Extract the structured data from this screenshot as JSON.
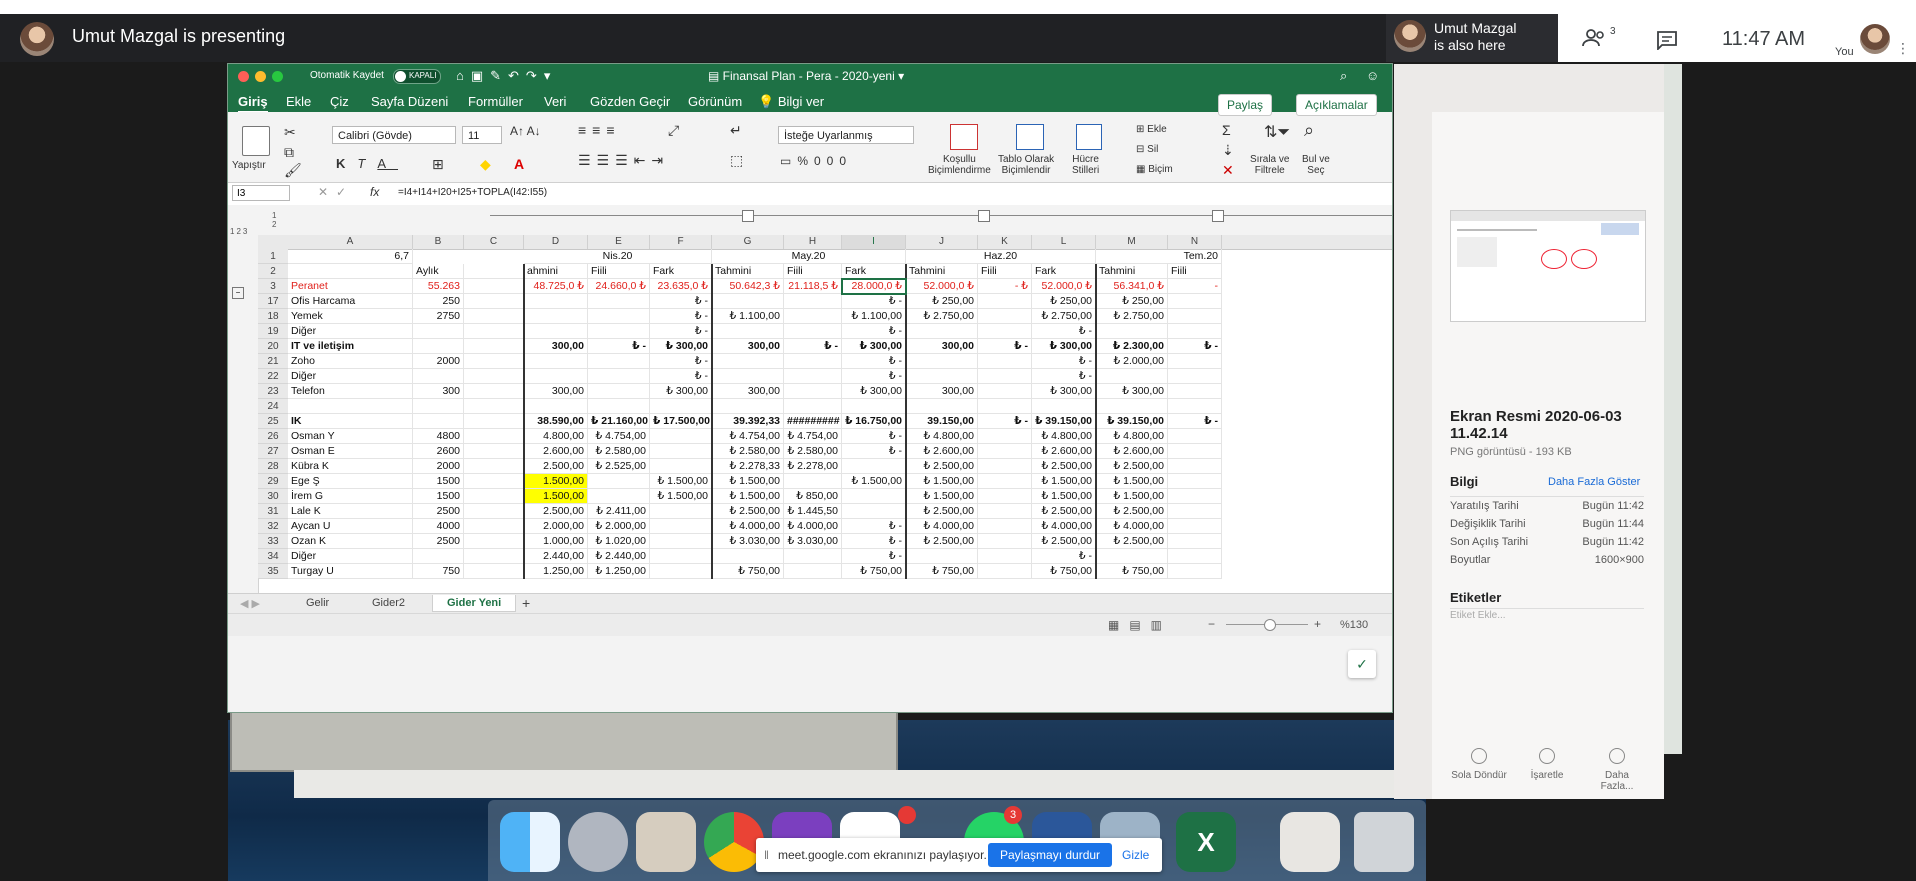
{
  "meet": {
    "presenter_text": "Umut Mazgal is presenting",
    "also_here_name": "Umut Mazgal",
    "also_here_suffix": "is also here",
    "people_count": "3",
    "time": "11:47 AM",
    "you_label": "You"
  },
  "excel": {
    "autosave_label": "Otomatik Kaydet",
    "autosave_state": "KAPALI",
    "doc_title": "Finansal Plan - Pera - 2020-yeni",
    "tabs": [
      "Giriş",
      "Ekle",
      "Çiz",
      "Sayfa Düzeni",
      "Formüller",
      "Veri",
      "Gözden Geçir",
      "Görünüm",
      "Bilgi ver"
    ],
    "share_label": "Paylaş",
    "comments_label": "Açıklamalar",
    "paste_label": "Yapıştır",
    "font_name": "Calibri (Gövde)",
    "font_size": "11",
    "number_format": "İsteğe Uyarlanmış",
    "ribbon_groups": {
      "conditional": "Koşullu\nBiçimlendirme",
      "table": "Tablo Olarak\nBiçimlendir",
      "cell_styles": "Hücre\nStilleri",
      "insert": "Ekle",
      "delete": "Sil",
      "format": "Biçim",
      "sort": "Sırala ve\nFiltrele",
      "find": "Bul ve\nSeç"
    },
    "name_box": "I3",
    "formula": "=I4+I14+I20+I25+TOPLA(I42:I55)",
    "columns": [
      "A",
      "B",
      "C",
      "D",
      "E",
      "F",
      "G",
      "H",
      "I",
      "J",
      "K",
      "L",
      "M",
      "N"
    ],
    "outline_levels": [
      "1",
      "2",
      "3"
    ],
    "row1": {
      "a": "6,7",
      "month_apr": "Nis.20",
      "month_may": "May.20",
      "month_jun": "Haz.20",
      "month_jul": "Tem.20"
    },
    "row2": {
      "b": "Aylık",
      "d": "ahmini",
      "e": "Fiili",
      "f": "Fark",
      "g": "Tahmini",
      "h": "Fiili",
      "i": "Fark",
      "j": "Tahmini",
      "k": "Fiili",
      "l": "Fark",
      "m": "Tahmini",
      "n": "Fiili"
    },
    "rows": [
      {
        "n": "3",
        "a": "Peranet",
        "b": "55.263",
        "d": "48.725,0 ₺",
        "e": "24.660,0 ₺",
        "f": "23.635,0 ₺",
        "g": "50.642,3 ₺",
        "h": "21.118,5 ₺",
        "i": "28.000,0 ₺",
        "j": "52.000,0 ₺",
        "k": "- ₺",
        "l": "52.000,0 ₺",
        "m": "56.341,0 ₺",
        "nn": "-"
      },
      {
        "n": "17",
        "a": "Ofis Harcama",
        "b": "250",
        "d": "",
        "e": "",
        "f": "₺ -",
        "g": "",
        "h": "",
        "i": "₺ -",
        "j": "₺ 250,00",
        "k": "",
        "l": "₺ 250,00",
        "m": "₺ 250,00",
        "nn": ""
      },
      {
        "n": "18",
        "a": "Yemek",
        "b": "2750",
        "d": "",
        "e": "",
        "f": "₺ -",
        "g": "₺ 1.100,00",
        "h": "",
        "i": "₺ 1.100,00",
        "j": "₺ 2.750,00",
        "k": "",
        "l": "₺ 2.750,00",
        "m": "₺ 2.750,00",
        "nn": ""
      },
      {
        "n": "19",
        "a": "Diğer",
        "b": "",
        "d": "",
        "e": "",
        "f": "₺ -",
        "g": "",
        "h": "",
        "i": "₺ -",
        "j": "",
        "k": "",
        "l": "₺ -",
        "m": "",
        "nn": ""
      },
      {
        "n": "20",
        "a": "IT ve iletişim",
        "b": "",
        "d": "300,00",
        "e": "₺ -",
        "f": "₺ 300,00",
        "g": "300,00",
        "h": "₺ -",
        "i": "₺ 300,00",
        "j": "300,00",
        "k": "₺ -",
        "l": "₺ 300,00",
        "m": "₺ 2.300,00",
        "nn": "₺ -",
        "bold": true
      },
      {
        "n": "21",
        "a": "Zoho",
        "b": "2000",
        "d": "",
        "e": "",
        "f": "₺ -",
        "g": "",
        "h": "",
        "i": "₺ -",
        "j": "",
        "k": "",
        "l": "₺ -",
        "m": "₺ 2.000,00",
        "nn": ""
      },
      {
        "n": "22",
        "a": "Diğer",
        "b": "",
        "d": "",
        "e": "",
        "f": "₺ -",
        "g": "",
        "h": "",
        "i": "₺ -",
        "j": "",
        "k": "",
        "l": "₺ -",
        "m": "",
        "nn": ""
      },
      {
        "n": "23",
        "a": "Telefon",
        "b": "300",
        "d": "300,00",
        "e": "",
        "f": "₺ 300,00",
        "g": "300,00",
        "h": "",
        "i": "₺ 300,00",
        "j": "300,00",
        "k": "",
        "l": "₺ 300,00",
        "m": "₺ 300,00",
        "nn": ""
      },
      {
        "n": "24",
        "a": "",
        "b": "",
        "d": "",
        "e": "",
        "f": "",
        "g": "",
        "h": "",
        "i": "",
        "j": "",
        "k": "",
        "l": "",
        "m": "",
        "nn": ""
      },
      {
        "n": "25",
        "a": "IK",
        "b": "",
        "d": "38.590,00",
        "e": "₺ 21.160,00",
        "f": "₺ 17.500,00",
        "g": "39.392,33",
        "h": "#########",
        "i": "₺ 16.750,00",
        "j": "39.150,00",
        "k": "₺ -",
        "l": "₺ 39.150,00",
        "m": "₺ 39.150,00",
        "nn": "₺ -",
        "bold": true
      },
      {
        "n": "26",
        "a": "Osman Y",
        "b": "4800",
        "d": "4.800,00",
        "e": "₺ 4.754,00",
        "f": "",
        "g": "₺ 4.754,00",
        "h": "₺ 4.754,00",
        "i": "₺ -",
        "j": "₺ 4.800,00",
        "k": "",
        "l": "₺ 4.800,00",
        "m": "₺ 4.800,00",
        "nn": ""
      },
      {
        "n": "27",
        "a": "Osman E",
        "b": "2600",
        "d": "2.600,00",
        "e": "₺ 2.580,00",
        "f": "",
        "g": "₺ 2.580,00",
        "h": "₺ 2.580,00",
        "i": "₺ -",
        "j": "₺ 2.600,00",
        "k": "",
        "l": "₺ 2.600,00",
        "m": "₺ 2.600,00",
        "nn": ""
      },
      {
        "n": "28",
        "a": "Kübra K",
        "b": "2000",
        "d": "2.500,00",
        "e": "₺ 2.525,00",
        "f": "",
        "g": "₺ 2.278,33",
        "h": "₺ 2.278,00",
        "i": "",
        "j": "₺ 2.500,00",
        "k": "",
        "l": "₺ 2.500,00",
        "m": "₺ 2.500,00",
        "nn": ""
      },
      {
        "n": "29",
        "a": "Ege Ş",
        "b": "1500",
        "d": "1.500,00",
        "e": "",
        "f": "₺ 1.500,00",
        "g": "₺ 1.500,00",
        "h": "",
        "i": "₺ 1.500,00",
        "j": "₺ 1.500,00",
        "k": "",
        "l": "₺ 1.500,00",
        "m": "₺ 1.500,00",
        "nn": "",
        "yel": true
      },
      {
        "n": "30",
        "a": "İrem G",
        "b": "1500",
        "d": "1.500,00",
        "e": "",
        "f": "₺ 1.500,00",
        "g": "₺ 1.500,00",
        "h": "₺ 850,00",
        "i": "",
        "j": "₺ 1.500,00",
        "k": "",
        "l": "₺ 1.500,00",
        "m": "₺ 1.500,00",
        "nn": "",
        "yel": true
      },
      {
        "n": "31",
        "a": "Lale K",
        "b": "2500",
        "d": "2.500,00",
        "e": "₺ 2.411,00",
        "f": "",
        "g": "₺ 2.500,00",
        "h": "₺ 1.445,50",
        "i": "",
        "j": "₺ 2.500,00",
        "k": "",
        "l": "₺ 2.500,00",
        "m": "₺ 2.500,00",
        "nn": ""
      },
      {
        "n": "32",
        "a": "Aycan U",
        "b": "4000",
        "d": "2.000,00",
        "e": "₺ 2.000,00",
        "f": "",
        "g": "₺ 4.000,00",
        "h": "₺ 4.000,00",
        "i": "₺ -",
        "j": "₺ 4.000,00",
        "k": "",
        "l": "₺ 4.000,00",
        "m": "₺ 4.000,00",
        "nn": ""
      },
      {
        "n": "33",
        "a": "Ozan K",
        "b": "2500",
        "d": "1.000,00",
        "e": "₺ 1.020,00",
        "f": "",
        "g": "₺ 3.030,00",
        "h": "₺ 3.030,00",
        "i": "₺ -",
        "j": "₺ 2.500,00",
        "k": "",
        "l": "₺ 2.500,00",
        "m": "₺ 2.500,00",
        "nn": ""
      },
      {
        "n": "34",
        "a": "Diğer",
        "b": "",
        "d": "2.440,00",
        "e": "₺ 2.440,00",
        "f": "",
        "g": "",
        "h": "",
        "i": "₺ -",
        "j": "",
        "k": "",
        "l": "₺ -",
        "m": "",
        "nn": ""
      },
      {
        "n": "35",
        "a": "Turgay U",
        "b": "750",
        "d": "1.250,00",
        "e": "₺ 1.250,00",
        "f": "",
        "g": "₺ 750,00",
        "h": "",
        "i": "₺ 750,00",
        "j": "₺ 750,00",
        "k": "",
        "l": "₺ 750,00",
        "m": "₺ 750,00",
        "nn": ""
      }
    ],
    "sheets": [
      "Gelir",
      "Gider2",
      "Gider Yeni"
    ],
    "zoom": "%130"
  },
  "preview": {
    "file_title": "Ekran Resmi 2020-06-03 11.42.14",
    "file_sub": "PNG görüntüsü - 193 KB",
    "info_heading": "Bilgi",
    "more_link": "Daha Fazla Göster",
    "info_rows": [
      {
        "k": "Yaratılış Tarihi",
        "v": "Bugün 11:42"
      },
      {
        "k": "Değişiklik Tarihi",
        "v": "Bugün 11:44"
      },
      {
        "k": "Son Açılış Tarihi",
        "v": "Bugün 11:42"
      },
      {
        "k": "Boyutlar",
        "v": "1600×900"
      }
    ],
    "tags_heading": "Etiketler",
    "tags_placeholder": "Etiket Ekle...",
    "actions": [
      "Sola Döndür",
      "İşaretle",
      "Daha\nFazla..."
    ]
  },
  "share_bar": {
    "text": "meet.google.com ekranınızı paylaşıyor.",
    "stop": "Paylaşmayı durdur",
    "hide": "Gizle"
  },
  "colors": {
    "excel_green": "#1e7145",
    "meet_bg": "#202124",
    "stop_blue": "#1a73e8",
    "highlight": "#ffff00",
    "negative_red": "#e0201b"
  }
}
